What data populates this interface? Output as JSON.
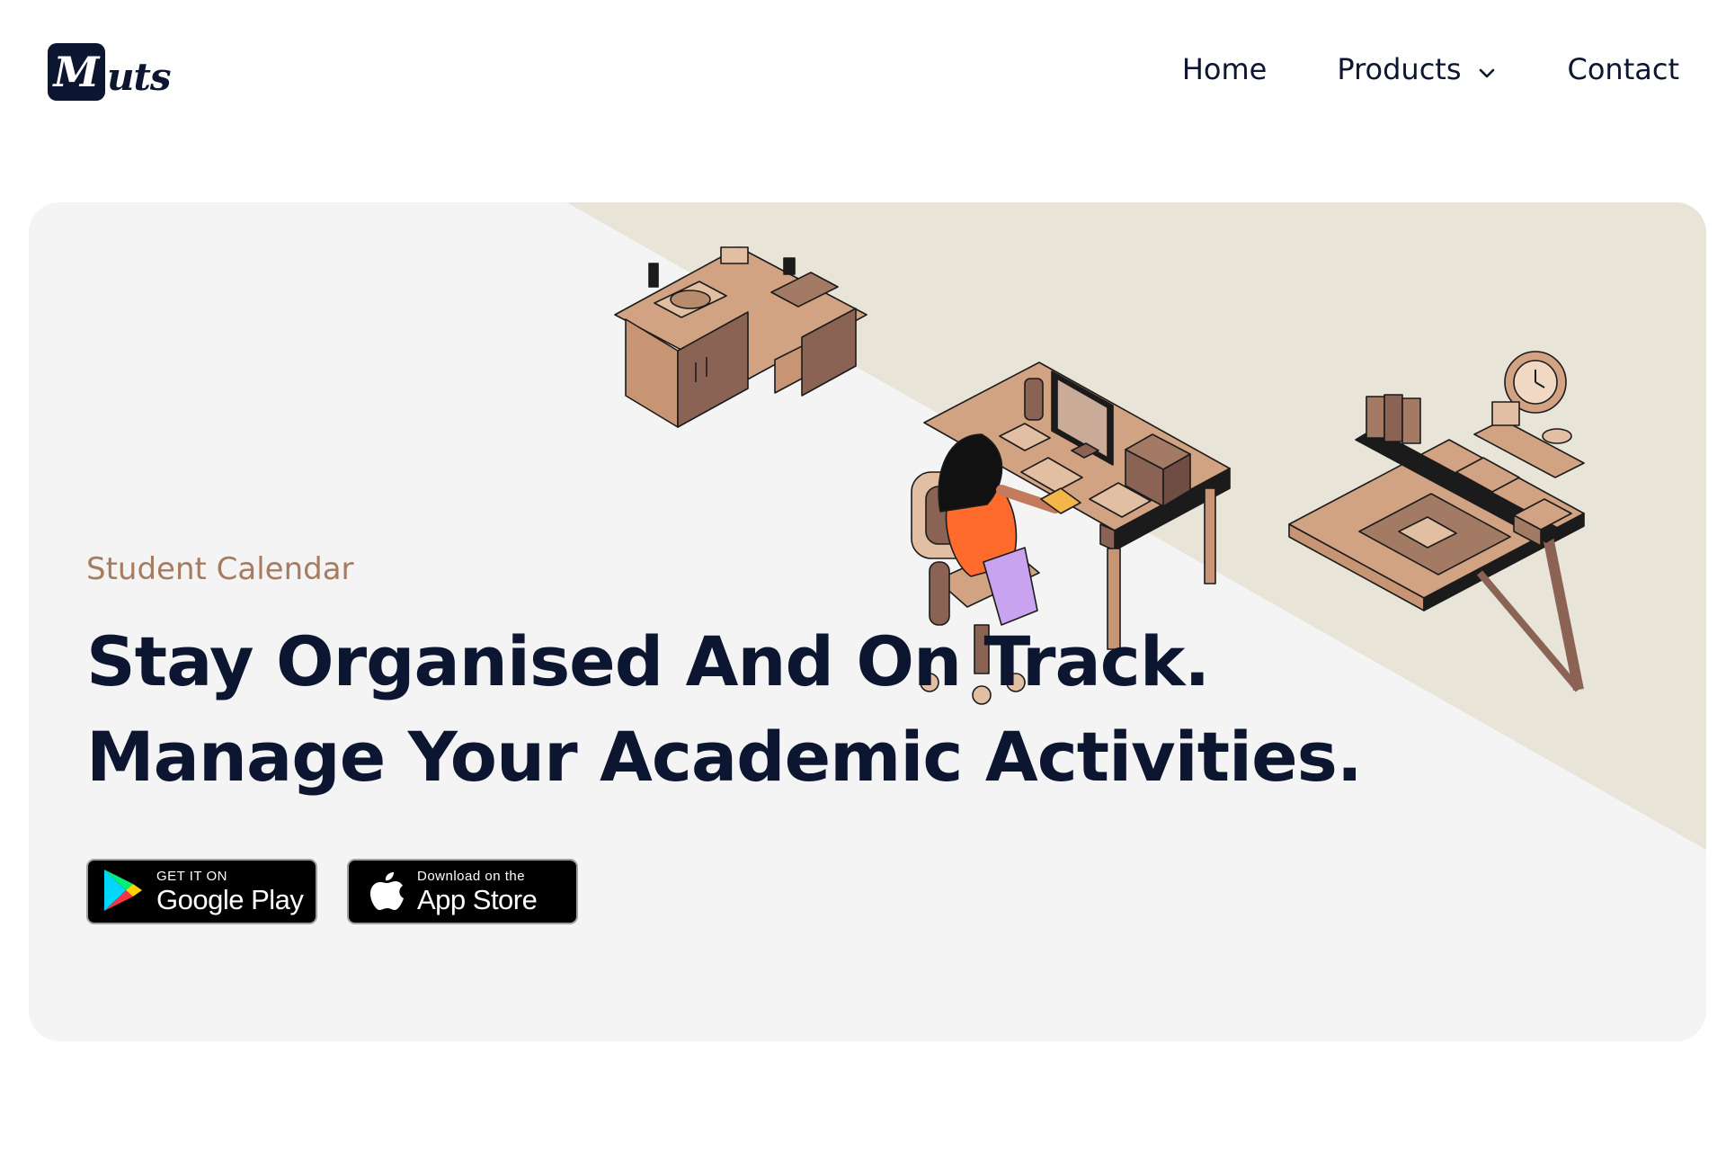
{
  "header": {
    "logo_mark": "M",
    "logo_rest": "uts",
    "nav": {
      "home": "Home",
      "products": "Products",
      "contact": "Contact"
    }
  },
  "hero": {
    "subtitle": "Student Calendar",
    "headline_line1": "Stay Organised And On Track.",
    "headline_line2": "Manage Your Academic Activities.",
    "google_play": {
      "small": "GET IT ON",
      "big": "Google Play"
    },
    "app_store": {
      "small": "Download on the",
      "big": "App Store"
    }
  },
  "colors": {
    "navy": "#0d1630",
    "accent_brown": "#a67b60",
    "card_bg": "#f4f4f4",
    "diagonal_bg": "#e8e4d8"
  },
  "icons": [
    "chevron-down-icon",
    "google-play-icon",
    "apple-icon"
  ]
}
